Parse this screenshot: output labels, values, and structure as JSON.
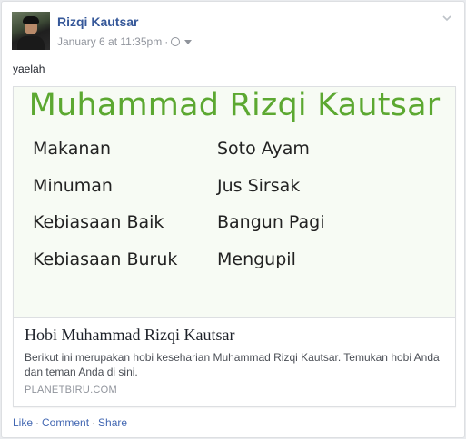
{
  "post": {
    "author": "Rizqi Kautsar",
    "timestamp": "January 6 at 11:35pm",
    "separator": "·",
    "audience_icon": "globe-icon",
    "status_text": "yaelah"
  },
  "link_preview": {
    "image": {
      "heading": "Muhammad Rizqi Kautsar",
      "rows": [
        {
          "label": "Makanan",
          "value": "Soto Ayam"
        },
        {
          "label": "Minuman",
          "value": "Jus Sirsak"
        },
        {
          "label": "Kebiasaan Baik",
          "value": "Bangun Pagi"
        },
        {
          "label": "Kebiasaan Buruk",
          "value": "Mengupil"
        }
      ]
    },
    "title": "Hobi Muhammad Rizqi Kautsar",
    "description": "Berikut ini merupakan hobi keseharian Muhammad Rizqi Kautsar. Temukan hobi Anda dan teman Anda di sini.",
    "domain": "PLANETBIRU.COM"
  },
  "actions": {
    "like": "Like",
    "comment": "Comment",
    "share": "Share",
    "separator": "·"
  },
  "colors": {
    "link": "#365899",
    "action": "#4267b2",
    "heading_green": "#5ca831",
    "meta_gray": "#90949c"
  }
}
